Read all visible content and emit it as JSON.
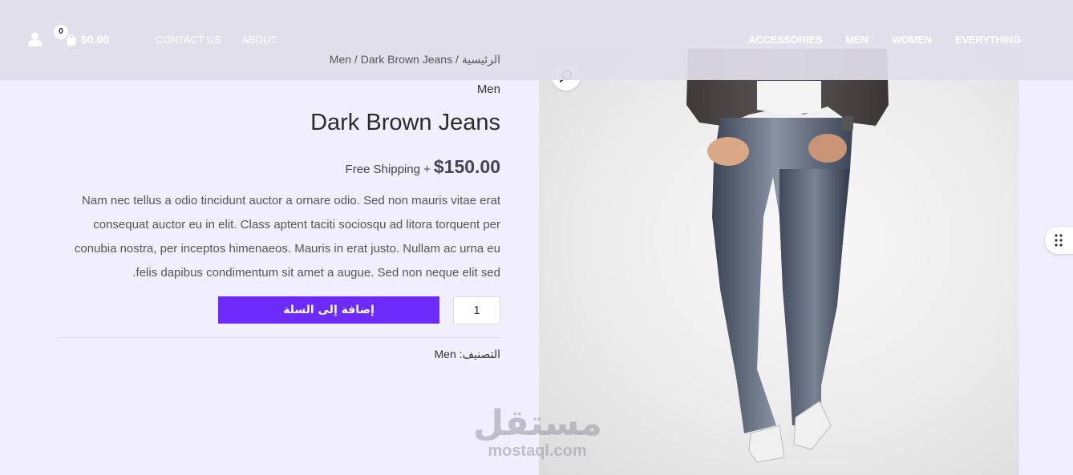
{
  "header": {
    "cart_count": "0",
    "cart_total": "$0.00",
    "nav_left": [
      "CONTACT US",
      "ABOUT"
    ],
    "nav_right": [
      "ACCESSORIES",
      "MEN",
      "WOMEN",
      "EVERYTHING"
    ]
  },
  "breadcrumb": {
    "home": "الرئيسية",
    "category": "Men",
    "current": "Dark Brown Jeans"
  },
  "product": {
    "category_label": "Men",
    "title": "Dark Brown Jeans",
    "price": "$150.00",
    "price_note": "Free Shipping +",
    "description": "Nam nec tellus a odio tincidunt auctor a ornare odio. Sed non mauris vitae erat consequat auctor eu in elit. Class aptent taciti sociosqu ad litora torquent per conubia nostra, per inceptos himenaeos. Mauris in erat justo. Nullam ac urna eu felis dapibus condimentum sit amet a augue. Sed non neque elit sed.",
    "quantity": "1",
    "add_to_cart": "إضافة إلى السلة",
    "meta_label": "التصنيف:",
    "meta_value": "Men"
  },
  "watermark": {
    "arabic": "مستقل",
    "latin": "mostaql.com"
  },
  "colors": {
    "accent": "#6d2bfa",
    "background": "#f1effd",
    "header_overlay": "#e0deeb"
  },
  "icons": [
    "user-icon",
    "cart-icon",
    "search-icon",
    "grip-dots-icon"
  ]
}
